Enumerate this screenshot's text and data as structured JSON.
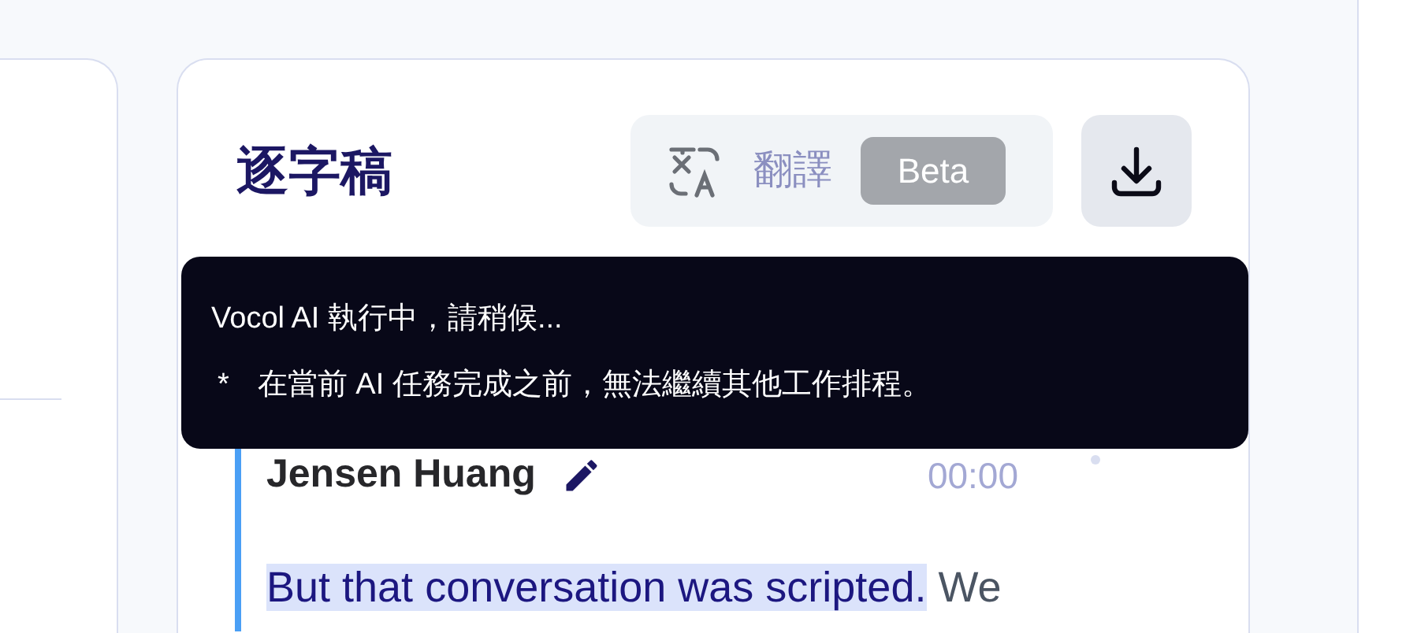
{
  "transcript_panel": {
    "title": "逐字稿",
    "translate": {
      "label": "翻譯",
      "badge": "Beta"
    }
  },
  "tooltip": {
    "status": "Vocol AI 執行中，請稍候...",
    "note_marker": "*",
    "note": "在當前 AI 任務完成之前，無法繼續其他工作排程。"
  },
  "entries": [
    {
      "speaker": "Jensen Huang",
      "time": "00:00",
      "segments": [
        {
          "text": "But that conversation was scripted.",
          "highlighted": true
        },
        {
          "text": " We",
          "highlighted": false
        }
      ]
    }
  ]
}
